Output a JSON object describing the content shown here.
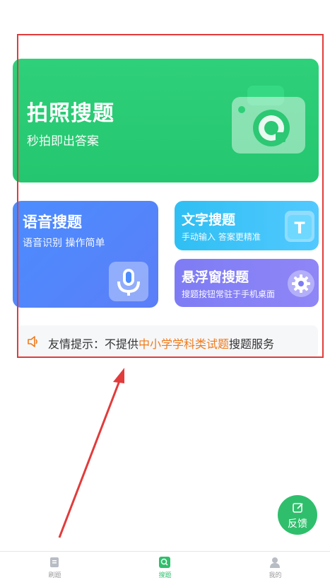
{
  "photo_card": {
    "title": "拍照搜题",
    "subtitle": "秒拍即出答案"
  },
  "voice_card": {
    "title": "语音搜题",
    "subtitle": "语音识别 操作简单"
  },
  "text_card": {
    "title": "文字搜题",
    "subtitle": "手动输入 答案更精准",
    "icon_letter": "T"
  },
  "float_card": {
    "title": "悬浮窗搜题",
    "subtitle": "搜题按钮常驻于手机桌面"
  },
  "notice": {
    "prefix": "友情提示：不提供",
    "highlight": "中小学学科类试题",
    "suffix": "搜题服务"
  },
  "fab": {
    "label": "反馈"
  },
  "tabs": [
    {
      "label": "刷题",
      "icon": "document-icon",
      "active": false
    },
    {
      "label": "搜题",
      "icon": "search-icon",
      "active": true
    },
    {
      "label": "我的",
      "icon": "user-icon",
      "active": false
    }
  ],
  "colors": {
    "primary_green": "#24c66f",
    "voice_blue": "#4b8dff",
    "text_cyan": "#2fbff3",
    "float_purple": "#7e7cf4",
    "highlight_orange": "#ef7a1a",
    "annotation_red": "#e23b3b"
  }
}
